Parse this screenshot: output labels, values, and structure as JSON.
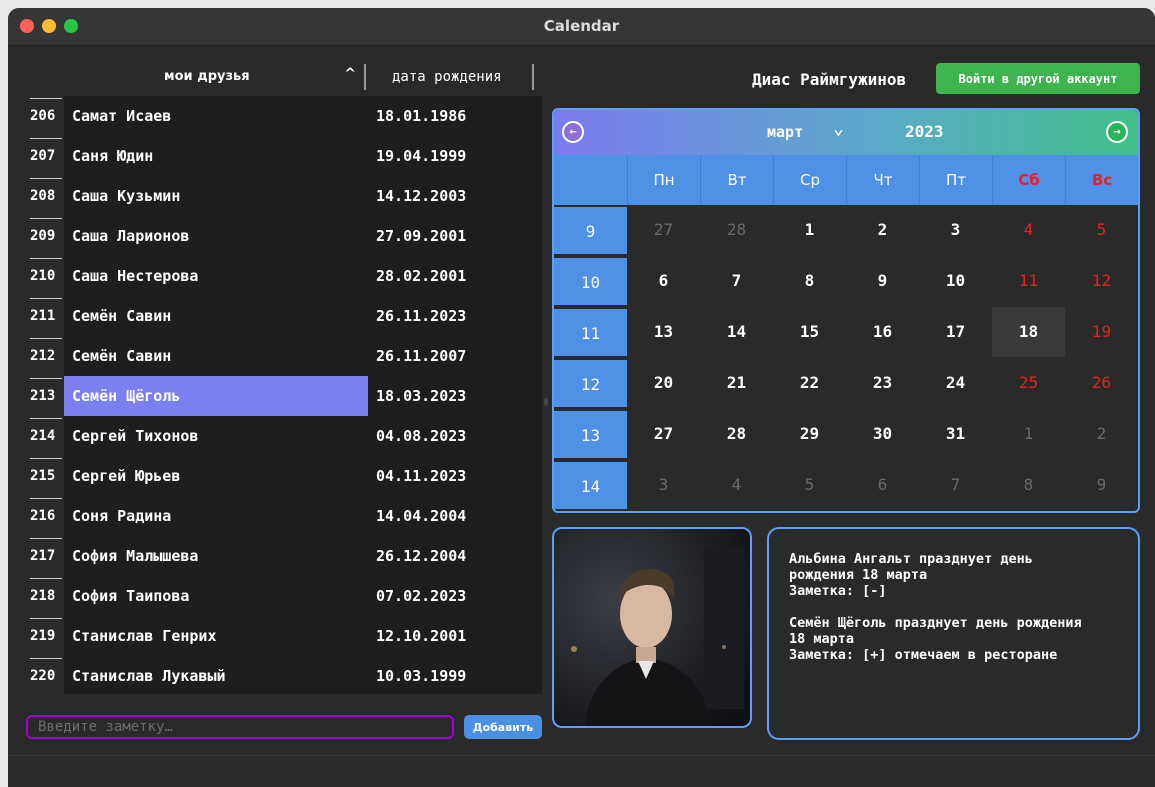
{
  "window": {
    "title": "Calendar"
  },
  "table": {
    "col_name": "мои друзья",
    "col_date": "дата рождения",
    "rows": [
      {
        "n": "206",
        "name": "Самат Исаев",
        "date": "18.01.1986"
      },
      {
        "n": "207",
        "name": "Саня Юдин",
        "date": "19.04.1999"
      },
      {
        "n": "208",
        "name": "Саша Кузьмин",
        "date": "14.12.2003"
      },
      {
        "n": "209",
        "name": "Саша Ларионов",
        "date": "27.09.2001"
      },
      {
        "n": "210",
        "name": "Саша Нестерова",
        "date": "28.02.2001"
      },
      {
        "n": "211",
        "name": "Семён Савин",
        "date": "26.11.2023"
      },
      {
        "n": "212",
        "name": "Семён Савин",
        "date": "26.11.2007"
      },
      {
        "n": "213",
        "name": "Семён Щёголь",
        "date": "18.03.2023",
        "selected": true
      },
      {
        "n": "214",
        "name": "Сергей Тихонов",
        "date": "04.08.2023"
      },
      {
        "n": "215",
        "name": "Сергей Юрьев",
        "date": "04.11.2023"
      },
      {
        "n": "216",
        "name": "Соня Радина",
        "date": "14.04.2004"
      },
      {
        "n": "217",
        "name": "София Малышева",
        "date": "26.12.2004"
      },
      {
        "n": "218",
        "name": "София Таипова",
        "date": "07.02.2023"
      },
      {
        "n": "219",
        "name": "Станислав Генрих",
        "date": "12.10.2001"
      },
      {
        "n": "220",
        "name": "Станислав Лукавый",
        "date": "10.03.1999"
      }
    ]
  },
  "note": {
    "placeholder": "Введите заметку…",
    "add_label": "Добавить"
  },
  "account": {
    "user_name": "Диас Раймгужинов",
    "switch_label": "Войти в другой аккаунт"
  },
  "calendar": {
    "month": "март",
    "year": "2023",
    "weekdays": [
      "Пн",
      "Вт",
      "Ср",
      "Чт",
      "Пт",
      "Сб",
      "Вс"
    ],
    "weeks": [
      {
        "wk": "9",
        "days": [
          {
            "d": "27",
            "m": true
          },
          {
            "d": "28",
            "m": true
          },
          {
            "d": "1"
          },
          {
            "d": "2"
          },
          {
            "d": "3"
          },
          {
            "d": "4",
            "w": true
          },
          {
            "d": "5",
            "w": true
          }
        ]
      },
      {
        "wk": "10",
        "days": [
          {
            "d": "6"
          },
          {
            "d": "7"
          },
          {
            "d": "8"
          },
          {
            "d": "9"
          },
          {
            "d": "10"
          },
          {
            "d": "11",
            "w": true
          },
          {
            "d": "12",
            "w": true
          }
        ]
      },
      {
        "wk": "11",
        "days": [
          {
            "d": "13"
          },
          {
            "d": "14"
          },
          {
            "d": "15"
          },
          {
            "d": "16"
          },
          {
            "d": "17"
          },
          {
            "d": "18",
            "t": true
          },
          {
            "d": "19",
            "w": true
          }
        ]
      },
      {
        "wk": "12",
        "days": [
          {
            "d": "20"
          },
          {
            "d": "21"
          },
          {
            "d": "22"
          },
          {
            "d": "23"
          },
          {
            "d": "24"
          },
          {
            "d": "25",
            "w": true
          },
          {
            "d": "26",
            "w": true
          }
        ]
      },
      {
        "wk": "13",
        "days": [
          {
            "d": "27"
          },
          {
            "d": "28"
          },
          {
            "d": "29"
          },
          {
            "d": "30"
          },
          {
            "d": "31"
          },
          {
            "d": "1",
            "m": true
          },
          {
            "d": "2",
            "m": true
          }
        ]
      },
      {
        "wk": "14",
        "days": [
          {
            "d": "3",
            "m": true
          },
          {
            "d": "4",
            "m": true
          },
          {
            "d": "5",
            "m": true
          },
          {
            "d": "6",
            "m": true
          },
          {
            "d": "7",
            "m": true
          },
          {
            "d": "8",
            "m": true
          },
          {
            "d": "9",
            "m": true
          }
        ]
      }
    ]
  },
  "info": {
    "messages": [
      "Альбина Ангальт празднует день\nрождения 18 марта\nЗаметка: [-]",
      "Семён Щёголь празднует день рождения\n18 марта\nЗаметка: [+] отмечаем в ресторане"
    ]
  },
  "colors": {
    "accent_blue": "#4e91e6",
    "selected_row": "#7b7ff0",
    "weekend_red": "#e8201f",
    "login_green": "#3fb34f",
    "note_border": "#a000d8"
  },
  "icons": {
    "sort": "chevron-up-icon",
    "prev_month": "arrow-left-circle-icon",
    "next_month": "arrow-right-circle-icon",
    "month_dropdown": "chevron-down-icon"
  }
}
